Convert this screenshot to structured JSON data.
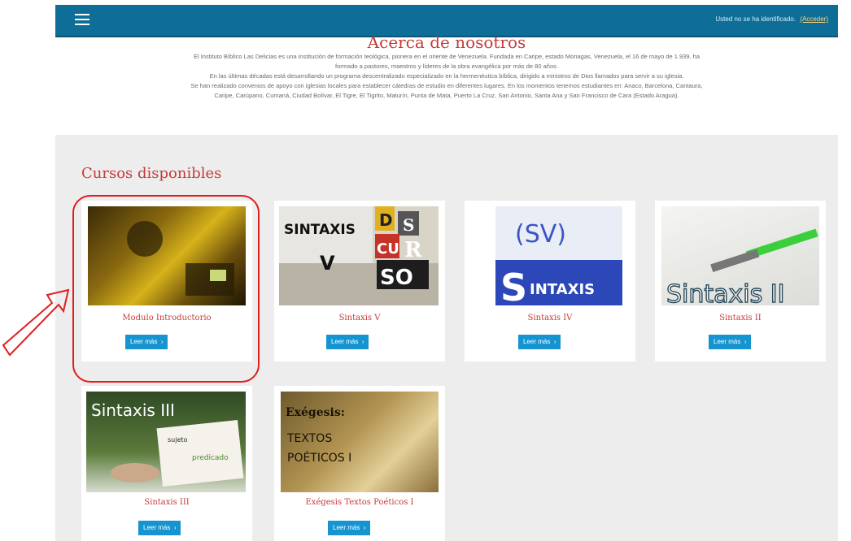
{
  "header": {
    "login_text": "Usted no se ha identificado.",
    "login_link": "(Acceder)"
  },
  "about": {
    "title": "Acerca de nosotros",
    "lines": [
      "El Instituto Bíblico Las Delicias es una institución de formación teológica, pionera en el oriente de Venezuela. Fundada en Caripe, estado Monagas, Venezuela, el 16 de mayo de 1.939, ha",
      "formado a pastores, maestros y líderes de la obra evangélica por más de 80 años.",
      "En las últimas décadas está desarrollando un programa descentralizado especializado en la hermenéutica bíblica, dirigido a ministros de Dios  llamados para servir a su iglesia.",
      "Se han realizado convenios de apoyo con iglesias locales para establecer cátedras de estudio en diferentes lugares. En los momentos tenemos estudiantes en: Anaco, Barcelona,  Cantaura,",
      "Caripe, Carúpano, Cumaná, Ciudad Bolívar, El Tigre, El Tigrito, Maturín, Punta de Mata, Puerto La Cruz,  San Antonio, Santa Ana y San Francisco de Cara (Estado Aragua)."
    ]
  },
  "courses": {
    "title": "Cursos disponibles",
    "button_label": "Leer más",
    "items": [
      {
        "name": "Modulo Introductorio"
      },
      {
        "name": "Sintaxis V"
      },
      {
        "name": "Sintaxis IV"
      },
      {
        "name": "Sintaxis II"
      },
      {
        "name": "Sintaxis III"
      },
      {
        "name": "Exégesis Textos Poéticos I"
      }
    ]
  },
  "thumb_text": {
    "sintaxis_v_word": "SINTAXIS",
    "sintaxis_v_letter": "V",
    "sintaxis_v_collage": [
      "D",
      "S",
      "CU",
      "R",
      "SO"
    ],
    "sintaxis_iv_top": "(SV)",
    "sintaxis_iv_bottom": "INTAXIS",
    "sintaxis_iv_s": "S",
    "sintaxis_ii_text": "Sintaxis II",
    "sintaxis_iii_text": "Sintaxis III",
    "sintaxis_iii_sujeto": "sujeto",
    "sintaxis_iii_predicado": "predicado",
    "exegesis_title": "Exégesis:",
    "exegesis_line1": "TEXTOS",
    "exegesis_line2": "POÉTICOS I"
  },
  "colors": {
    "topbar": "#0f6e98",
    "accent_red": "#c73a3a",
    "button_blue": "#1594d0",
    "annotation_red": "#e01e1e"
  }
}
